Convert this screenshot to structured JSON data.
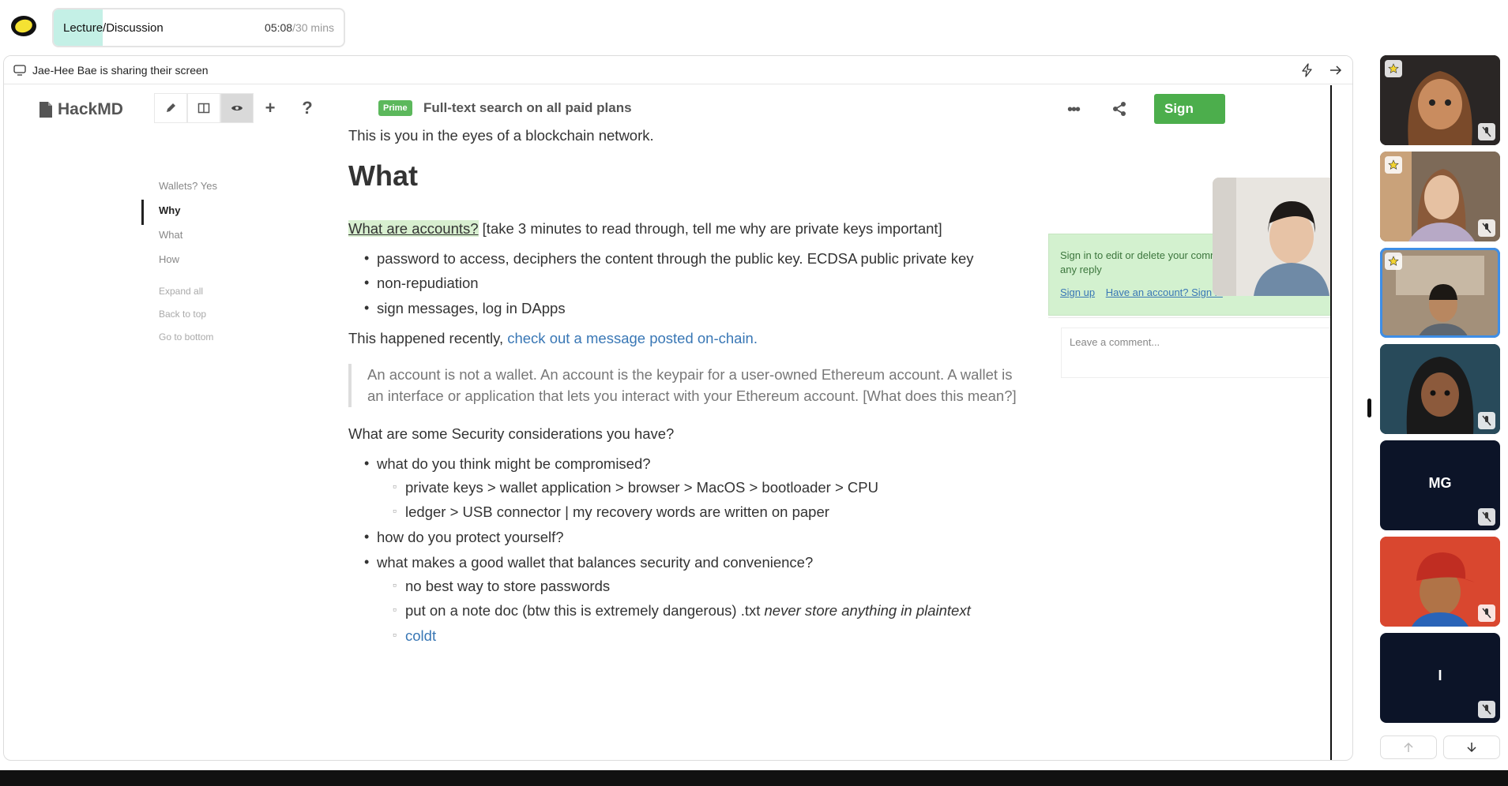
{
  "session": {
    "title": "Lecture/Discussion",
    "elapsed": "05:08",
    "total": "/30 mins",
    "progress": 0.17
  },
  "share": {
    "status_text": "Jae-Hee Bae is sharing their screen"
  },
  "hackmd": {
    "logo_text": "HackMD",
    "prime_badge": "Prime",
    "prime_text": "Full-text search on all paid plans",
    "signin_label": "Sign",
    "more_label": "•••"
  },
  "toc": {
    "items": [
      "Wallets? Yes",
      "Why",
      "What",
      "How"
    ],
    "active": "Why",
    "actions": [
      "Expand all",
      "Back to top",
      "Go to bottom"
    ]
  },
  "doc": {
    "intro": "This is you in the eyes of a blockchain network.",
    "heading": "What",
    "accounts_link": "What are accounts?",
    "accounts_note": " [take 3 minutes to read through, tell me why are private keys important]",
    "bullets1": [
      "password to access, deciphers the content through the public key. ECDSA public private key",
      "non-repudiation",
      "sign messages, log in DApps"
    ],
    "happened_text": "This happened recently, ",
    "happened_link": "check out a message posted on-chain.",
    "quote": "An account is not a wallet. An account is the keypair for a user-owned Ethereum account. A wallet is an interface or application that lets you interact with your Ethereum account. [What does this mean?]",
    "security_q": "What are some Security considerations you have?",
    "q1": "what do you think might be compromised?",
    "q1_subs": [
      "private keys > wallet application > browser > MacOS > bootloader > CPU",
      "ledger > USB connector | my recovery words are written on paper"
    ],
    "q2": "how do you protect yourself?",
    "q3": "what makes a good wallet that balances security and convenience?",
    "q3_sub1": "no best way to store passwords",
    "q3_sub2_a": "put on a note doc (btw this is extremely dangerous) .txt ",
    "q3_sub2_em": "never store anything in plaintext",
    "q3_sub3": "coldt"
  },
  "comments": {
    "message": "Sign in to edit or delete your comments and be notified of any reply",
    "signup": "Sign up",
    "have_account": "Have an account? Sign in",
    "placeholder": "Leave a comment..."
  },
  "participants": [
    {
      "kind": "avatar",
      "bg": "#2a2a2a",
      "starred": true,
      "muted": true
    },
    {
      "kind": "video",
      "bg": "#6b5b4e",
      "starred": true,
      "muted": true
    },
    {
      "kind": "video",
      "bg": "#8a7a6a",
      "starred": true,
      "muted": false,
      "selected": true
    },
    {
      "kind": "avatar",
      "bg": "#1f3a47",
      "starred": false,
      "muted": true
    },
    {
      "kind": "initials",
      "initials": "MG",
      "bg": "#0c1428",
      "muted": true
    },
    {
      "kind": "avatar",
      "bg": "#d6452f",
      "starred": false,
      "muted": true
    },
    {
      "kind": "initials",
      "initials": "I",
      "bg": "#0c1428",
      "muted": true
    }
  ],
  "colors": {
    "accent_teal": "#c4f0e6",
    "hackmd_green": "#4cae4c",
    "link_blue": "#3977b5",
    "selected_blue": "#3e8ee6"
  }
}
